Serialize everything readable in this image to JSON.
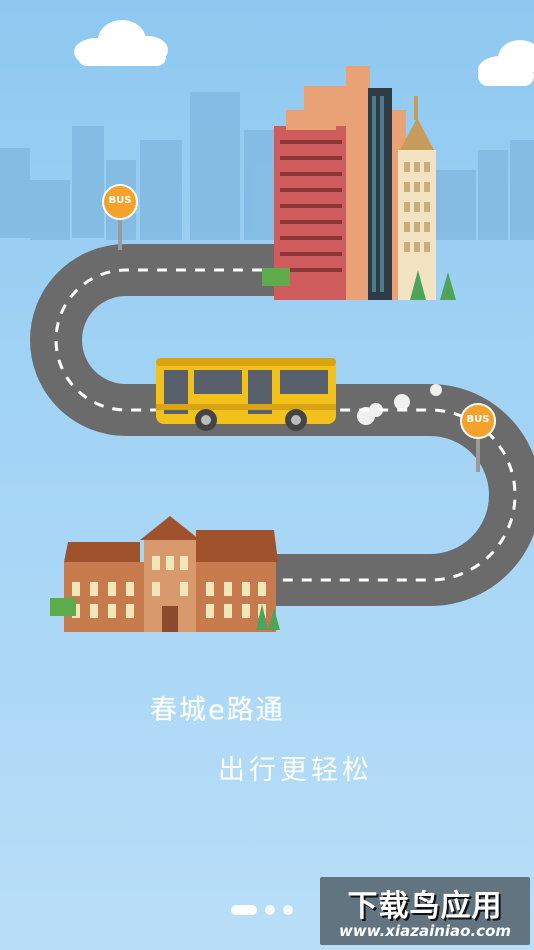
{
  "splash": {
    "slogan_line1": "春城e路通",
    "slogan_line2": "出行更轻松"
  },
  "bus_stop_label": "BUS",
  "pager": {
    "total_pages": 3,
    "current_page": 1
  },
  "watermark": {
    "title": "下载鸟应用",
    "url": "www.xiazainiao.com"
  },
  "colors": {
    "sky": "#a3d4f5",
    "road": "#6b6b6b",
    "bus_body": "#f3c11b",
    "stop_sign": "#f4a22c"
  }
}
